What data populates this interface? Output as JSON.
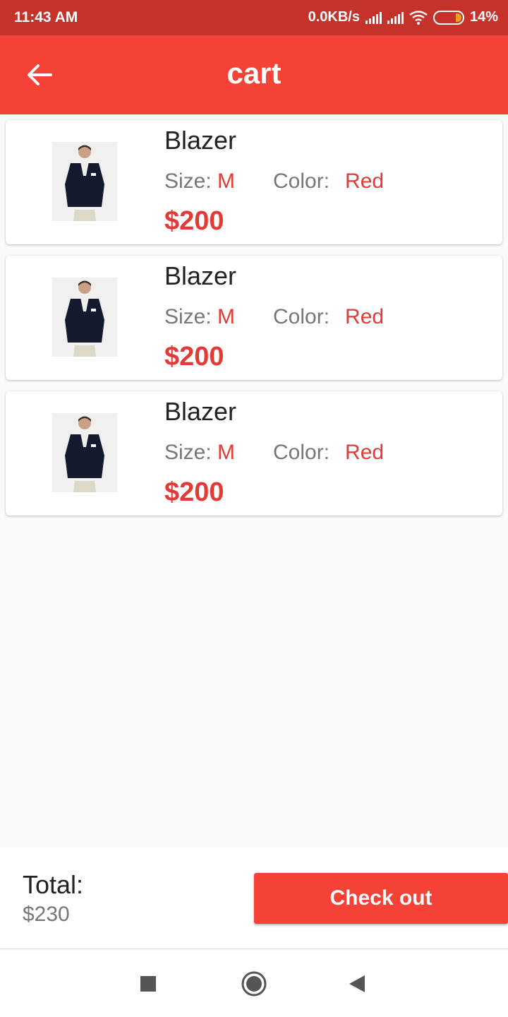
{
  "status": {
    "time": "11:43 AM",
    "network_speed": "0.0KB/s",
    "battery": "14%"
  },
  "header": {
    "title": "cart",
    "back_icon": "arrow-back-icon"
  },
  "cart": {
    "items": [
      {
        "name": "Blazer",
        "size_label": "Size:",
        "size": "M",
        "color_label": "Color:",
        "color": "Red",
        "price": "$200",
        "image_icon": "blazer-photo"
      },
      {
        "name": "Blazer",
        "size_label": "Size:",
        "size": "M",
        "color_label": "Color:",
        "color": "Red",
        "price": "$200",
        "image_icon": "blazer-photo"
      },
      {
        "name": "Blazer",
        "size_label": "Size:",
        "size": "M",
        "color_label": "Color:",
        "color": "Red",
        "price": "$200",
        "image_icon": "blazer-photo"
      }
    ]
  },
  "footer": {
    "total_label": "Total:",
    "total_value": "$230",
    "checkout_label": "Check out"
  },
  "colors": {
    "primary": "#f44336",
    "status_bar": "#c4322a",
    "accent_text": "#e53935"
  }
}
